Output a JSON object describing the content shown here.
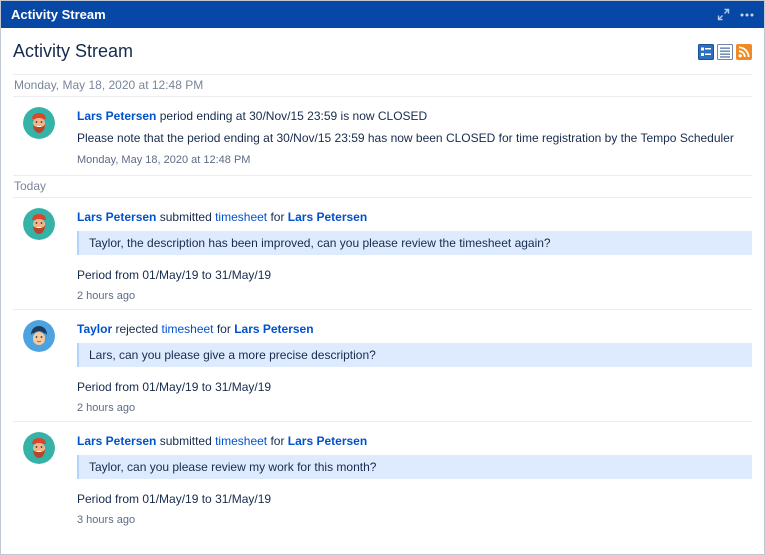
{
  "window": {
    "title": "Activity Stream"
  },
  "gadget": {
    "title": "Activity Stream"
  },
  "groups": [
    {
      "label": "Monday, May 18, 2020 at 12:48 PM",
      "entries": [
        {
          "actor": "Lars Petersen",
          "headline_text": " period ending at 30/Nov/15 23:59 is now CLOSED",
          "description": "Please note that the period ending at 30/Nov/15 23:59 has now been CLOSED for time registration by the Tempo Scheduler",
          "timestamp": "Monday, May 18, 2020 at 12:48 PM"
        }
      ]
    },
    {
      "label": "Today",
      "entries": [
        {
          "actor": "Lars Petersen",
          "verb": " submitted ",
          "object": "timesheet",
          "prep": " for ",
          "target": "Lars Petersen",
          "comment": "Taylor, the description has been improved, can you please review the timesheet again?",
          "period": "Period from 01/May/19 to 31/May/19",
          "timestamp": "2 hours ago"
        },
        {
          "actor": "Taylor",
          "verb": " rejected ",
          "object": "timesheet",
          "prep": " for ",
          "target": "Lars Petersen",
          "comment": "Lars, can you please give a more precise description?",
          "period": "Period from 01/May/19 to 31/May/19",
          "timestamp": "2 hours ago"
        },
        {
          "actor": "Lars Petersen",
          "verb": " submitted ",
          "object": "timesheet",
          "prep": " for ",
          "target": "Lars Petersen",
          "comment": "Taylor, can you please review my work for this month?",
          "period": "Period from 01/May/19 to 31/May/19",
          "timestamp": "3 hours ago"
        }
      ]
    }
  ],
  "colors": {
    "header_bg": "#0747a6",
    "link": "#0052cc",
    "comment_bg": "#deebff",
    "avatar_lars_bg": "#36b3a8",
    "avatar_taylor_bg": "#4ca3e0"
  }
}
